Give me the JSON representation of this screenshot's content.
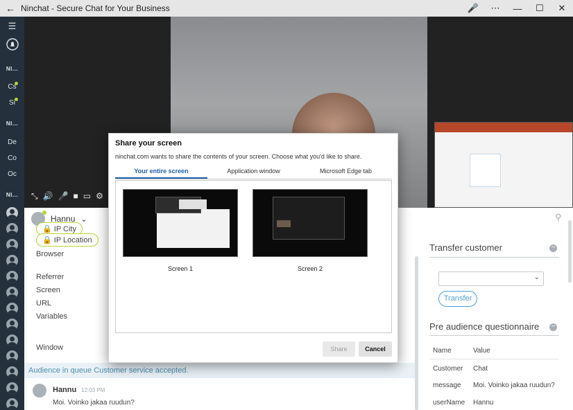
{
  "window": {
    "back_icon": "arrow-left-icon",
    "title": "Ninchat - Secure Chat for Your Business",
    "controls": [
      "mic-icon",
      "more-icon",
      "minimize-icon",
      "maximize-icon",
      "close-icon"
    ]
  },
  "rail": {
    "menu_icon": "hamburger-icon",
    "bell_icon": "bell-icon",
    "groups": [
      "NI...",
      "NI...",
      "NI..."
    ],
    "channels": [
      "Cs",
      "Si",
      "De",
      "Co",
      "Oc"
    ]
  },
  "video": {
    "controls": [
      "expand-icon",
      "volume-icon",
      "mic-icon",
      "camera-icon",
      "screen-icon",
      "settings-icon"
    ]
  },
  "main": {
    "user_name": "Hannu",
    "chips": [
      "IP City",
      "IP Location"
    ],
    "meta_labels": [
      "Browser",
      "Referrer",
      "Screen",
      "URL",
      "Variables",
      "Window"
    ],
    "notice": "Audience in queue Customer service accepted.",
    "message": {
      "name": "Hannu",
      "time": "12:03 PM",
      "text": "Moi. Voinko jakaa ruudun?"
    }
  },
  "right": {
    "transfer_title": "Transfer customer",
    "transfer_button": "Transfer",
    "questionnaire_title": "Pre audience questionnaire",
    "table_headers": [
      "Name",
      "Value"
    ],
    "rows": [
      {
        "name": "Customer",
        "value": "Chat"
      },
      {
        "name": "message",
        "value": "Moi. Voinko jakaa ruudun?"
      },
      {
        "name": "userName",
        "value": "Hannu"
      }
    ]
  },
  "dialog": {
    "title": "Share your screen",
    "subtitle": "ninchat.com wants to share the contents of your screen. Choose what you'd like to share.",
    "tabs": [
      "Your entire screen",
      "Application window",
      "Microsoft Edge tab"
    ],
    "screens": [
      "Screen 1",
      "Screen 2"
    ],
    "share_label": "Share",
    "cancel_label": "Cancel"
  },
  "colors": {
    "rail_bg": "#24313c",
    "accent_green": "#b5d334",
    "link_blue": "#4f9ed1",
    "tab_blue": "#1f5fa8",
    "notice_bg": "#e9f1f6"
  }
}
